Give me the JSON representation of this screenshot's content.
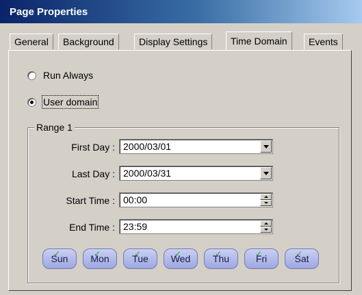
{
  "window": {
    "title": "Page Properties"
  },
  "tabs": [
    {
      "label": "General",
      "active": false
    },
    {
      "label": "Background",
      "active": false
    },
    {
      "label": "Display Settings",
      "active": false
    },
    {
      "label": "Time Domain",
      "active": true
    },
    {
      "label": "Events",
      "active": false
    }
  ],
  "time_domain": {
    "options": [
      {
        "label": "Run Always",
        "checked": false
      },
      {
        "label": "User domain",
        "checked": true
      }
    ],
    "range": {
      "title": "Range 1",
      "first_day": {
        "label": "First Day :",
        "value": "2000/03/01"
      },
      "last_day": {
        "label": "Last Day :",
        "value": "2000/03/31"
      },
      "start_time": {
        "label": "Start Time :",
        "value": "00:00"
      },
      "end_time": {
        "label": "End Time :",
        "value": "23:59"
      },
      "days": [
        {
          "label": "Sun",
          "checked": true
        },
        {
          "label": "Mon",
          "checked": true
        },
        {
          "label": "Tue",
          "checked": true
        },
        {
          "label": "Wed",
          "checked": true
        },
        {
          "label": "Thu",
          "checked": true
        },
        {
          "label": "Fri",
          "checked": true
        },
        {
          "label": "Sat",
          "checked": true
        }
      ]
    }
  },
  "colors": {
    "title_bar": "#0a246a",
    "face": "#d4d0c8",
    "day_button": "#b4bcec",
    "check": "#2f9a2f"
  },
  "icons": {
    "dropdown": "chevron-down-icon",
    "spin_up": "arrow-up-icon",
    "spin_down": "arrow-down-icon",
    "check": "check-icon"
  }
}
